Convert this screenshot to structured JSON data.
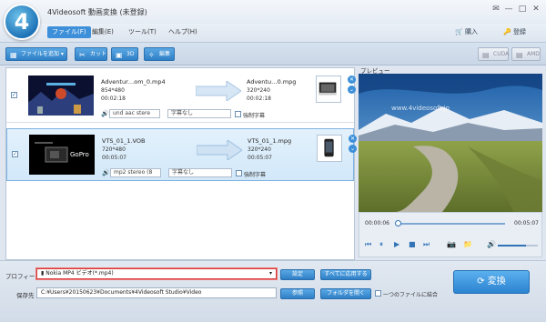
{
  "app": {
    "title": "4Videosoft 動画変換 (未登録)",
    "logo": "4"
  },
  "menu": {
    "file": "ファイル(F)",
    "edit": "編集(E)",
    "tools": "ツール(T)",
    "help": "ヘルプ(H)",
    "buy": "購入",
    "register": "登録"
  },
  "toolbar": {
    "add_file": "ファイルを追加",
    "cut": "カット",
    "three_d": "3D",
    "edit": "編集",
    "cuda": "CUDA",
    "amd": "AMD"
  },
  "files": [
    {
      "src_name": "Adventur…om_0.mp4",
      "src_res": "854*480",
      "src_dur": "00:02:18",
      "dst_name": "Adventu…0.mpg",
      "dst_res": "320*240",
      "dst_dur": "00:02:18",
      "audio": "und aac stere",
      "subtitle": "字幕なし",
      "force_sub": "強制字幕"
    },
    {
      "src_name": "VTS_01_1.VOB",
      "src_res": "720*480",
      "src_dur": "00:05:07",
      "dst_name": "VTS_01_1.mpg",
      "dst_res": "320*240",
      "dst_dur": "00:05:07",
      "audio": "mp2 stereo (8",
      "subtitle": "字幕なし",
      "force_sub": "強制字幕",
      "thumb_text": "GoPro"
    }
  ],
  "preview": {
    "label": "プレビュー",
    "watermark": "www.4videosoft.jp",
    "time_current": "00:00:06",
    "time_total": "00:05:07",
    "progress": 0.02,
    "volume": 0.7
  },
  "bottom": {
    "profile_label": "プロフィール",
    "profile_value": "Nokia MP4 ビデオ(*.mp4)",
    "settings": "設定",
    "apply_all": "すべてに応用する",
    "save_label": "保存先",
    "save_path": "C:¥Users¥20150623¥Documents¥4Videosoft Studio¥Video",
    "browse": "参照",
    "open_folder": "フォルダを開く",
    "merge": "一つのファイルに結合",
    "convert": "変換"
  },
  "colors": {
    "accent": "#3c8fd8",
    "highlight": "#d23a3a"
  },
  "icons": [
    "close-icon",
    "minimize-icon",
    "maximize-icon",
    "cart-icon",
    "key-icon",
    "scissors-icon",
    "star-icon",
    "play-icon",
    "pause-icon",
    "stop-icon",
    "camera-icon",
    "folder-icon",
    "volume-icon",
    "refresh-icon"
  ]
}
